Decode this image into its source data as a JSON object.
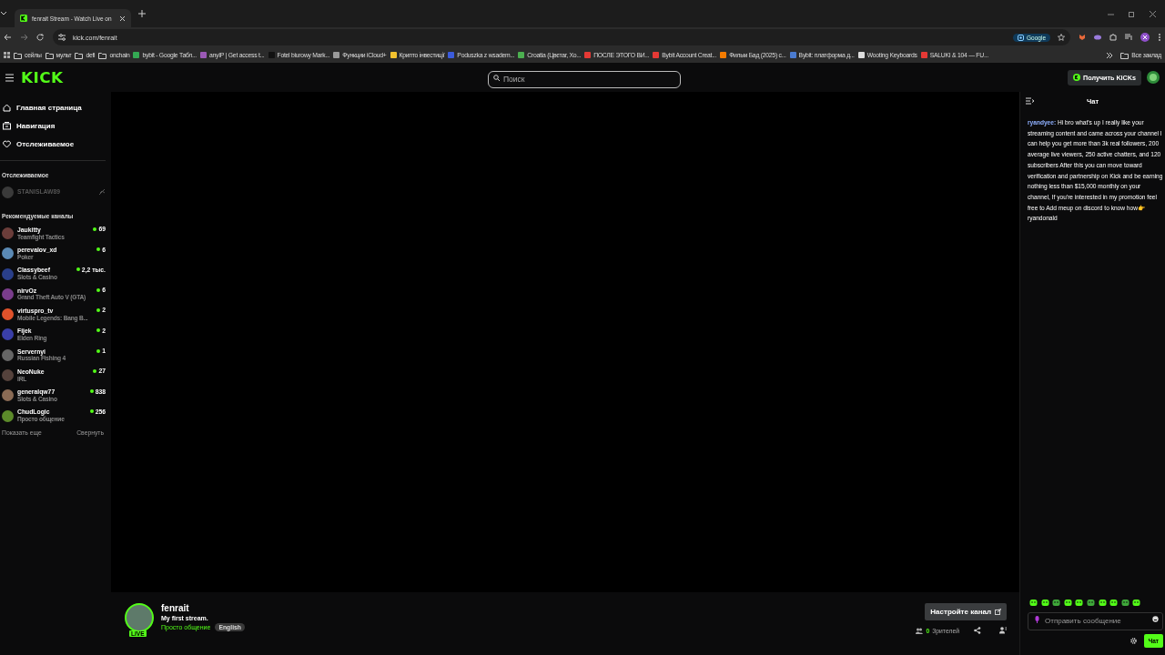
{
  "browser": {
    "tab": {
      "title": "fenrait Stream - Watch Live on ",
      "selected": true
    },
    "url": "kick.com/fenrait",
    "search_chip": "Google",
    "bookmarks": [
      {
        "kind": "folder",
        "label": "сейлы"
      },
      {
        "kind": "folder",
        "label": "мульт"
      },
      {
        "kind": "folder",
        "label": "defi"
      },
      {
        "kind": "folder",
        "label": "onchain"
      },
      {
        "kind": "site",
        "label": "bybit - Google Табл...",
        "color": "#34a853"
      },
      {
        "kind": "site",
        "label": "anyIP | Get access t...",
        "color": "#9b59b6"
      },
      {
        "kind": "site",
        "label": "Fotel biurowy Mark...",
        "color": "#111111"
      },
      {
        "kind": "site",
        "label": "Функции iCloud+",
        "color": "#9a9a9a"
      },
      {
        "kind": "site",
        "label": "Крипто інвестиції",
        "color": "#f2c12e"
      },
      {
        "kind": "site",
        "label": "Poduszka z wsadem...",
        "color": "#3b5bdb"
      },
      {
        "kind": "site",
        "label": "Croatia (Цвєтаг, Хо...",
        "color": "#4caf50"
      },
      {
        "kind": "site",
        "label": "ПОСЛЕ ЭТОГО ВИ...",
        "color": "#e53935"
      },
      {
        "kind": "site",
        "label": "Bybit Account Creat...",
        "color": "#e53935"
      },
      {
        "kind": "site",
        "label": "Фильм Бад (2025) с...",
        "color": "#f57c00"
      },
      {
        "kind": "site",
        "label": "Bybit: платформа д...",
        "color": "#4a7bd0"
      },
      {
        "kind": "site",
        "label": "Wooting Keyboards",
        "color": "#dddddd"
      },
      {
        "kind": "site",
        "label": "SALUKI & 104 — FU...",
        "color": "#e53935"
      }
    ],
    "all_bookmarks": "Все заклад"
  },
  "header": {
    "logo": "KICK",
    "search": {
      "placeholder": "Поиск"
    },
    "get_kicks": "Получить KICKs"
  },
  "sidebar": {
    "nav": [
      {
        "kind": "home",
        "label": "Главная страница"
      },
      {
        "kind": "browse",
        "label": "Навигация"
      },
      {
        "kind": "following",
        "label": "Отслеживаемое"
      }
    ],
    "following": {
      "title": "Отслеживаемое",
      "channels": [
        {
          "name": "STANISLAW89",
          "live": false
        }
      ]
    },
    "recommended": {
      "title": "Рекомендуемые каналы",
      "channels": [
        {
          "name": "Jaukitty",
          "category": "Teamfight Tactics",
          "viewers": "69",
          "live": true
        },
        {
          "name": "perevalov_xd",
          "category": "Poker",
          "viewers": "6",
          "live": true
        },
        {
          "name": "Classybeef",
          "category": "Slots & Casino",
          "viewers": "2,2 тыс.",
          "live": true
        },
        {
          "name": "nirvOz",
          "category": "Grand Theft Auto V (GTA)",
          "viewers": "6",
          "live": true
        },
        {
          "name": "virtuspro_tv",
          "category": "Mobile Legends: Bang B...",
          "viewers": "2",
          "live": true
        },
        {
          "name": "Fijek",
          "category": "Elden Ring",
          "viewers": "2",
          "live": true
        },
        {
          "name": "Servernyi",
          "category": "Russian Fishing 4",
          "viewers": "1",
          "live": true
        },
        {
          "name": "NeoNuke",
          "category": "IRL",
          "viewers": "27",
          "live": true
        },
        {
          "name": "generalqw77",
          "category": "Slots & Casino",
          "viewers": "838",
          "live": true
        },
        {
          "name": "ChudLogic",
          "category": "Просто общение",
          "viewers": "256",
          "live": true
        }
      ]
    },
    "show_more": "Показать еще",
    "collapse": "Свернуть"
  },
  "stream": {
    "channel": "fenrait",
    "live_badge": "LIVE",
    "title": "My first stream.",
    "category": "Просто общение",
    "tags": [
      "English"
    ],
    "customize_button": "Настройте канал",
    "viewers_count": "0",
    "viewers_label": "Зрителей"
  },
  "chat": {
    "title": "Чат",
    "messages": [
      {
        "user": "ryandyee:",
        "text": "Hi bro what's up I really like your streaming content and came across your channel I can help you get more than 3k real followers, 200 average live viewers, 250 active chatters, and 120 subscribers After this you can move toward verification and partnership on Kick and be earning nothing less than $15,000 monthly on your channel, If you're interested in my promotion feel free to Add meup on discord to know how👉 ryandonald"
      }
    ],
    "input": {
      "placeholder": "Отправить сообщение"
    },
    "send_button": "Чат"
  }
}
